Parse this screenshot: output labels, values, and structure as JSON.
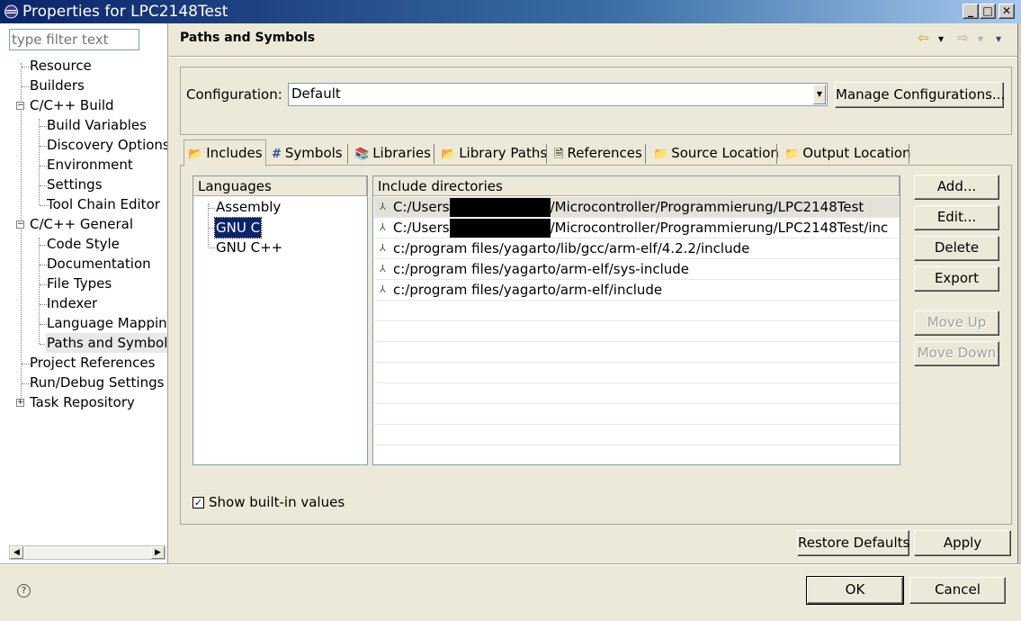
{
  "window": {
    "title": "Properties for LPC2148Test",
    "minimize": "_",
    "maximize": "□",
    "close": "✕",
    "icon": "eclipse-icon"
  },
  "nav": {
    "filter_placeholder": "type filter text",
    "items": [
      {
        "label": "Resource"
      },
      {
        "label": "Builders"
      },
      {
        "label": "C/C++ Build"
      },
      {
        "label": "Build Variables"
      },
      {
        "label": "Discovery Options"
      },
      {
        "label": "Environment"
      },
      {
        "label": "Settings"
      },
      {
        "label": "Tool Chain Editor"
      },
      {
        "label": "C/C++ General"
      },
      {
        "label": "Code Style"
      },
      {
        "label": "Documentation"
      },
      {
        "label": "File Types"
      },
      {
        "label": "Indexer"
      },
      {
        "label": "Language Mapping"
      },
      {
        "label": "Paths and Symbols"
      },
      {
        "label": "Project References"
      },
      {
        "label": "Run/Debug Settings"
      },
      {
        "label": "Task Repository"
      }
    ],
    "collapse_glyph": "−",
    "expand_glyph": "+",
    "scroll_left": "◀",
    "scroll_right": "▶"
  },
  "header": {
    "page_title": "Paths and Symbols",
    "back_arrow": "⇦",
    "forward_arrow": "⇨",
    "dropdown": "▾"
  },
  "config": {
    "label": "Configuration:",
    "value": "Default",
    "arrow": "▼",
    "manage_button": "Manage Configurations..."
  },
  "tabs": [
    {
      "label": "Includes",
      "icon": "📂"
    },
    {
      "label": "Symbols",
      "icon": "#"
    },
    {
      "label": "Libraries",
      "icon": "📚"
    },
    {
      "label": "Library Paths",
      "icon": "📂"
    },
    {
      "label": "References",
      "icon": "🗎"
    },
    {
      "label": "Source Location",
      "icon": "📁"
    },
    {
      "label": "Output Location",
      "icon": "📁"
    }
  ],
  "languages": {
    "header": "Languages",
    "items": [
      "Assembly",
      "GNU C",
      "GNU C++"
    ],
    "selected": "GNU C"
  },
  "includes": {
    "header": "Include directories",
    "row_icon": "⅄",
    "rows": [
      {
        "prefix": "C:/Users",
        "redacted": true,
        "suffix": "/Microcontroller/Programmierung/LPC2148Test"
      },
      {
        "prefix": "C:/Users",
        "redacted": true,
        "suffix": "/Microcontroller/Programmierung/LPC2148Test/inc"
      },
      {
        "prefix": "c:/program files/yagarto/lib/gcc/arm-elf/4.2.2/include",
        "redacted": false,
        "suffix": ""
      },
      {
        "prefix": "c:/program files/yagarto/arm-elf/sys-include",
        "redacted": false,
        "suffix": ""
      },
      {
        "prefix": "c:/program files/yagarto/arm-elf/include",
        "redacted": false,
        "suffix": ""
      }
    ]
  },
  "side_buttons": {
    "add": "Add...",
    "edit": "Edit...",
    "delete": "Delete",
    "export": "Export",
    "move_up": "Move Up",
    "move_down": "Move Down"
  },
  "show_builtin": {
    "label": "Show built-in values",
    "checked": true,
    "mark": "✓"
  },
  "footer": {
    "restore_defaults": "Restore Defaults",
    "apply": "Apply",
    "ok": "OK",
    "cancel": "Cancel",
    "help": "?"
  }
}
